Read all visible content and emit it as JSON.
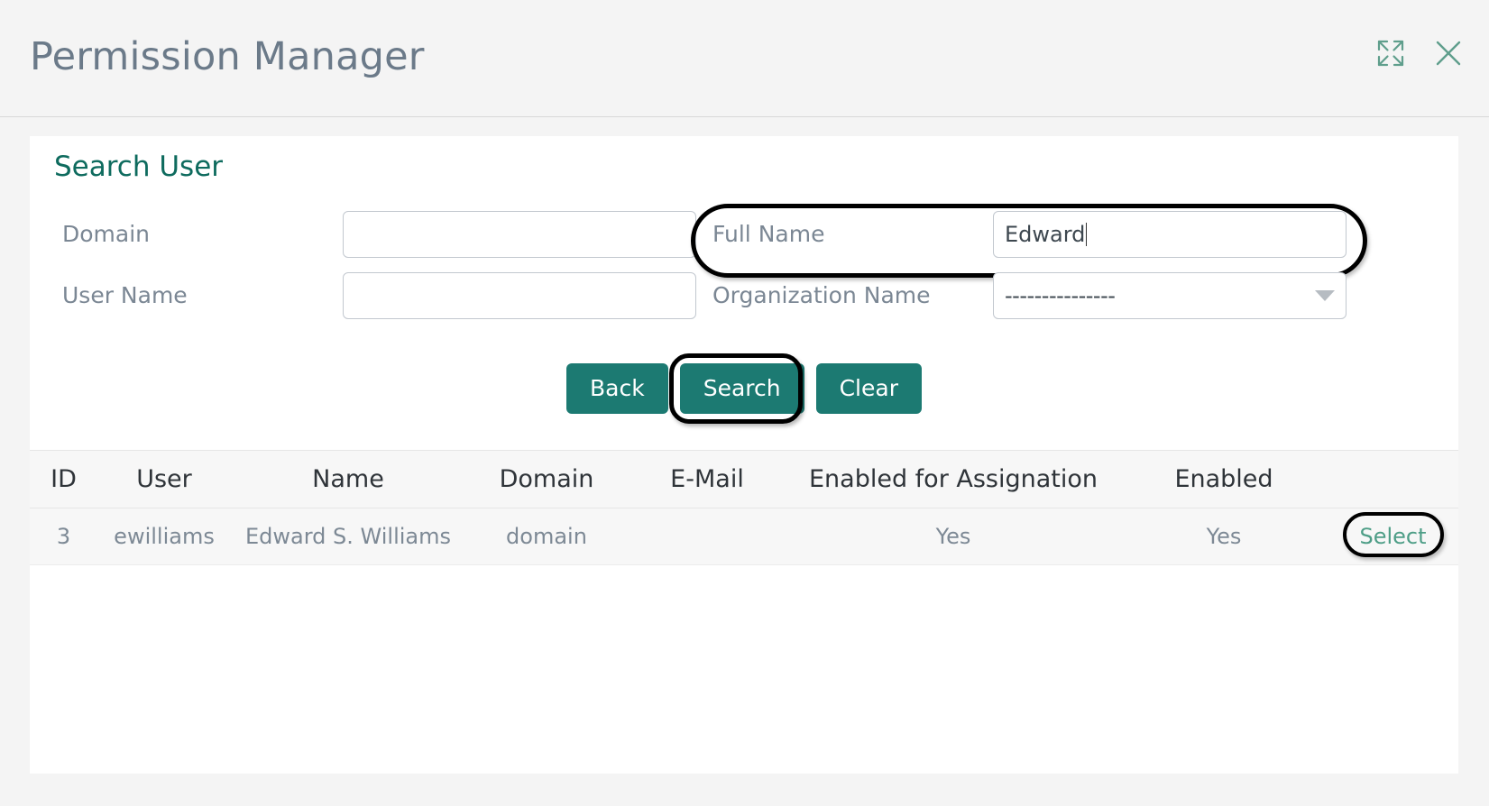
{
  "window": {
    "title": "Permission Manager",
    "expand_icon": "expand-icon",
    "close_icon": "close-icon"
  },
  "card": {
    "title": "Search User"
  },
  "form": {
    "fields": [
      {
        "label": "Domain",
        "value": "",
        "placeholder": ""
      },
      {
        "label": "User Name",
        "value": "",
        "placeholder": ""
      },
      {
        "label": "Full Name",
        "value": "Edward",
        "placeholder": ""
      },
      {
        "label": "Organization Name",
        "value": "---------------",
        "placeholder": ""
      }
    ]
  },
  "buttons": {
    "back": "Back",
    "search": "Search",
    "clear": "Clear"
  },
  "table": {
    "columns": [
      "ID",
      "User",
      "Name",
      "Domain",
      "E-Mail",
      "Enabled for Assignation",
      "Enabled",
      ""
    ],
    "rows": [
      {
        "id": "3",
        "user": "ewilliams",
        "name": "Edward S. Williams",
        "domain": "domain",
        "email": "",
        "enabled_for_assignation": "Yes",
        "enabled": "Yes",
        "action": "Select"
      }
    ]
  },
  "colors": {
    "accent": "#1c7a72",
    "title": "#6b7a89",
    "card_title": "#0e6b5e",
    "link": "#4e9e87",
    "page_bg": "#f4f4f4"
  }
}
